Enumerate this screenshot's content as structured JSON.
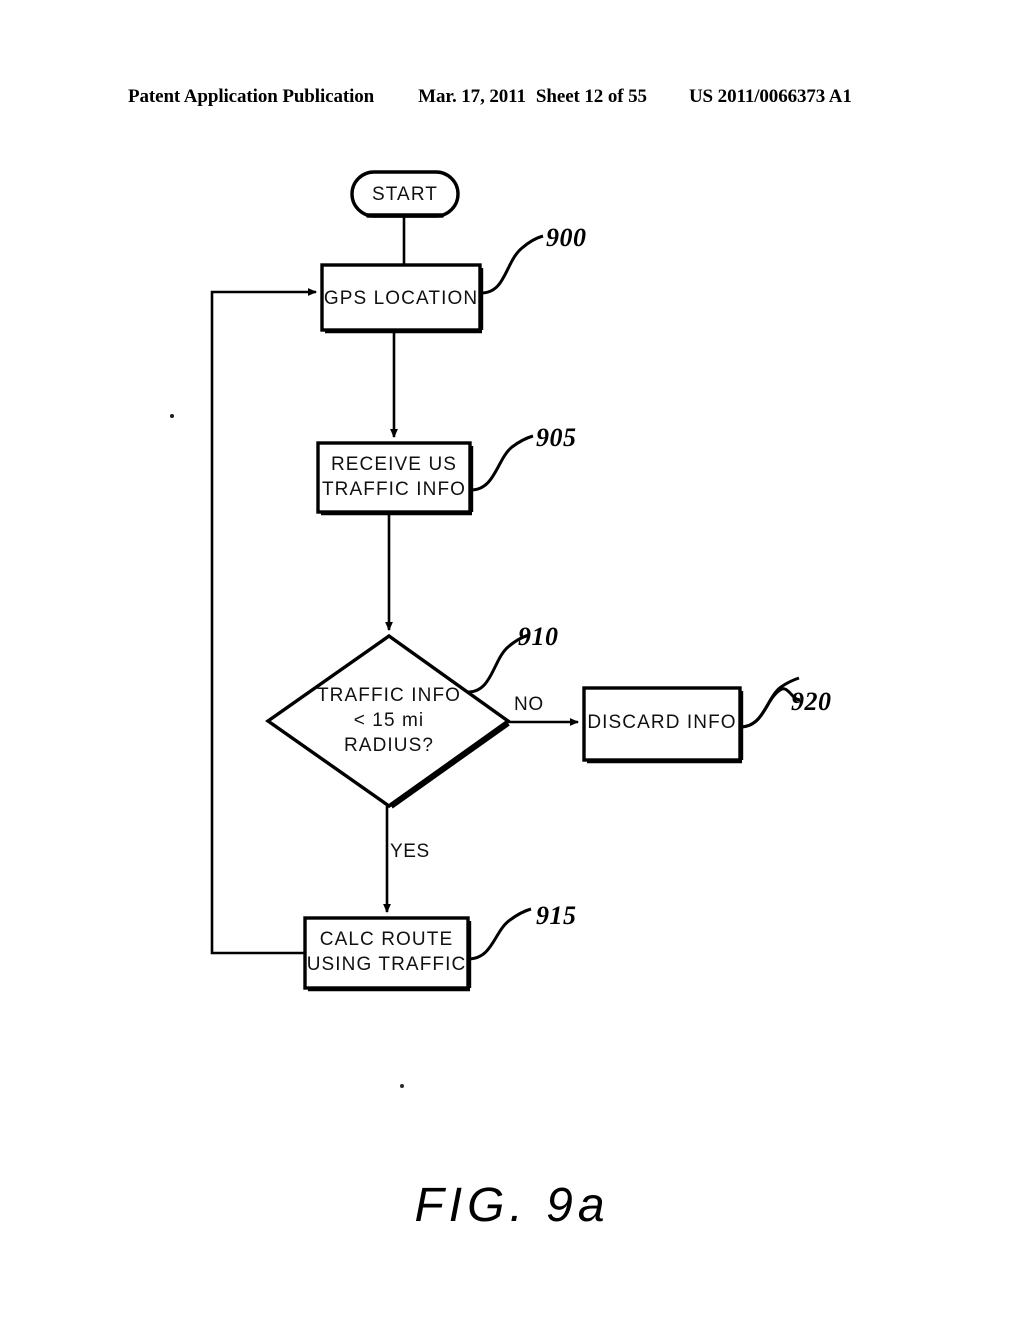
{
  "header": {
    "publication": "Patent Application Publication",
    "date": "Mar. 17, 2011",
    "sheet": "Sheet 12 of 55",
    "document_number": "US 2011/0066373 A1"
  },
  "figure": {
    "caption": "FIG.  9a",
    "type": "flowchart",
    "nodes": [
      {
        "id": "start",
        "shape": "rounded-terminator",
        "label": "START",
        "ref": null
      },
      {
        "id": "gps",
        "shape": "rectangle",
        "label": "GPS LOCATION",
        "ref": "900"
      },
      {
        "id": "receive",
        "shape": "rectangle",
        "label": "RECEIVE US\nTRAFFIC INFO",
        "ref": "905"
      },
      {
        "id": "decide",
        "shape": "diamond",
        "label": "TRAFFIC INFO\n< 15 mi\nRADIUS?",
        "ref": "910"
      },
      {
        "id": "discard",
        "shape": "rectangle",
        "label": "DISCARD INFO",
        "ref": "920"
      },
      {
        "id": "calc",
        "shape": "rectangle",
        "label": "CALC ROUTE\nUSING TRAFFIC",
        "ref": "915"
      }
    ],
    "edges": [
      {
        "from": "start",
        "to": "gps",
        "label": ""
      },
      {
        "from": "gps",
        "to": "receive",
        "label": ""
      },
      {
        "from": "receive",
        "to": "decide",
        "label": ""
      },
      {
        "from": "decide",
        "to": "discard",
        "label": "NO"
      },
      {
        "from": "decide",
        "to": "calc",
        "label": "YES"
      },
      {
        "from": "calc",
        "to": "gps",
        "label": ""
      }
    ],
    "branch_labels": {
      "no": "NO",
      "yes": "YES"
    },
    "ink_color": "#000000",
    "paper_color": "#ffffff"
  }
}
